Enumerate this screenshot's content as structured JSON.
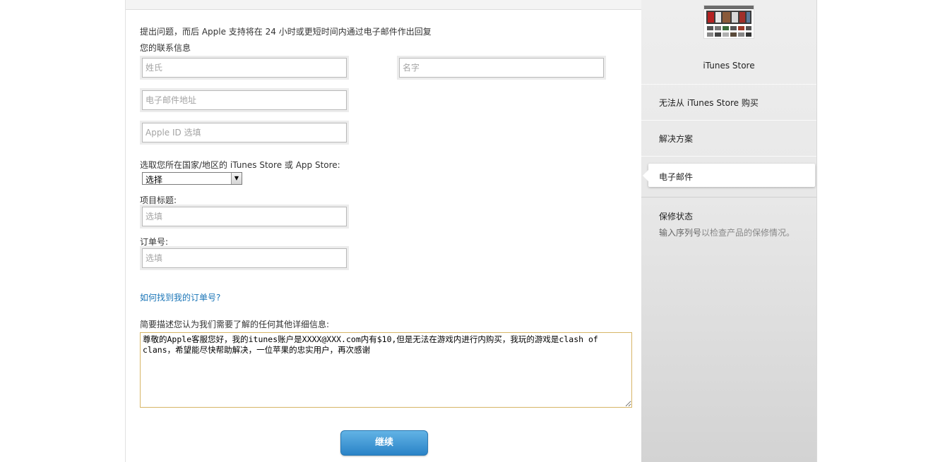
{
  "form": {
    "intro": "提出问题，而后 Apple 支持将在 24 小时或更短时间内通过电子邮件作出回复",
    "contact_label": "您的联系信息",
    "last_name_placeholder": "姓氏",
    "first_name_placeholder": "名字",
    "email_placeholder": "电子邮件地址",
    "apple_id_placeholder": "Apple ID 选填",
    "country_label": "选取您所在国家/地区的 iTunes Store 或 App Store:",
    "country_selected": "选择",
    "item_title_label": "项目标题:",
    "item_title_placeholder": "选填",
    "order_label": "订单号:",
    "order_placeholder": "选填",
    "find_order_link": "如何找到我的订单号?",
    "details_label": "简要描述您认为我们需要了解的任何其他详细信息:",
    "details_value": "尊敬的Apple客服您好，我的itunes账户是XXXX@XXX.com内有$10,但是无法在游戏内进行内购买，我玩的游戏是clash of clans，希望能尽快帮助解决，一位苹果的忠实用户，再次感谢",
    "continue_button": "继续"
  },
  "sidebar": {
    "product_title": "iTunes Store",
    "items": [
      {
        "label": "无法从 iTunes Store 购买"
      },
      {
        "label": "解决方案"
      },
      {
        "label": "电子邮件"
      }
    ],
    "warranty_title": "保修状态",
    "warranty_link": "输入序列号",
    "warranty_desc": "以检查产品的保修情况。"
  },
  "colors": {
    "accent": "#1a75b7",
    "button": "#2a83c7",
    "textarea_border": "#d7b567"
  }
}
